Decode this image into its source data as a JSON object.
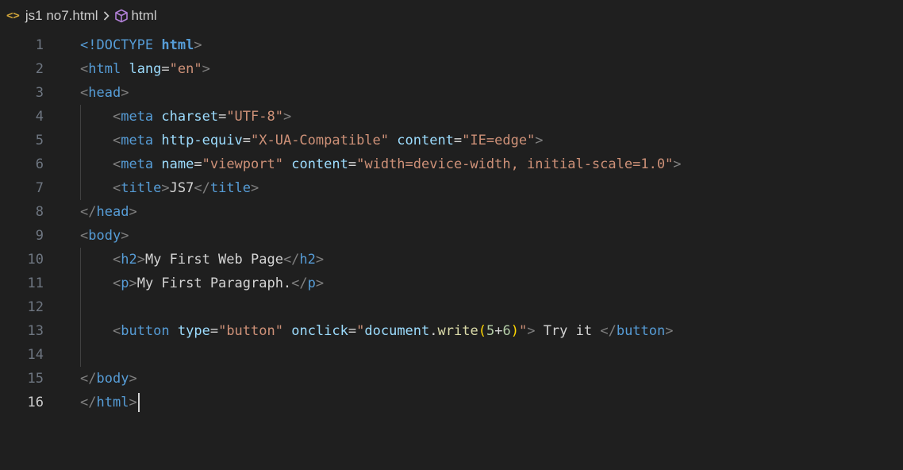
{
  "breadcrumb": {
    "file_icon": "<>",
    "file": "js1 no7.html",
    "separator": ">",
    "symbol_icon": "cube-icon",
    "symbol": "html"
  },
  "editor": {
    "active_line": 16,
    "lines": [
      {
        "n": "1",
        "tokens": [
          {
            "t": "<!DOCTYPE ",
            "c": "tag"
          },
          {
            "t": "html",
            "c": "tagb"
          },
          {
            "t": ">",
            "c": "bracket"
          }
        ]
      },
      {
        "n": "2",
        "tokens": [
          {
            "t": "<",
            "c": "bracket"
          },
          {
            "t": "html",
            "c": "tag"
          },
          {
            "t": " ",
            "c": "text"
          },
          {
            "t": "lang",
            "c": "attr"
          },
          {
            "t": "=",
            "c": "eq"
          },
          {
            "t": "\"en\"",
            "c": "str"
          },
          {
            "t": ">",
            "c": "bracket"
          }
        ]
      },
      {
        "n": "3",
        "tokens": [
          {
            "t": "<",
            "c": "bracket"
          },
          {
            "t": "head",
            "c": "tag"
          },
          {
            "t": ">",
            "c": "bracket"
          }
        ]
      },
      {
        "n": "4",
        "tokens": [
          {
            "t": "    ",
            "c": "text"
          },
          {
            "t": "<",
            "c": "bracket"
          },
          {
            "t": "meta",
            "c": "tag"
          },
          {
            "t": " ",
            "c": "text"
          },
          {
            "t": "charset",
            "c": "attr"
          },
          {
            "t": "=",
            "c": "eq"
          },
          {
            "t": "\"UTF-8\"",
            "c": "str"
          },
          {
            "t": ">",
            "c": "bracket"
          }
        ]
      },
      {
        "n": "5",
        "tokens": [
          {
            "t": "    ",
            "c": "text"
          },
          {
            "t": "<",
            "c": "bracket"
          },
          {
            "t": "meta",
            "c": "tag"
          },
          {
            "t": " ",
            "c": "text"
          },
          {
            "t": "http-equiv",
            "c": "attr"
          },
          {
            "t": "=",
            "c": "eq"
          },
          {
            "t": "\"X-UA-Compatible\"",
            "c": "str"
          },
          {
            "t": " ",
            "c": "text"
          },
          {
            "t": "content",
            "c": "attr"
          },
          {
            "t": "=",
            "c": "eq"
          },
          {
            "t": "\"IE=edge\"",
            "c": "str"
          },
          {
            "t": ">",
            "c": "bracket"
          }
        ]
      },
      {
        "n": "6",
        "tokens": [
          {
            "t": "    ",
            "c": "text"
          },
          {
            "t": "<",
            "c": "bracket"
          },
          {
            "t": "meta",
            "c": "tag"
          },
          {
            "t": " ",
            "c": "text"
          },
          {
            "t": "name",
            "c": "attr"
          },
          {
            "t": "=",
            "c": "eq"
          },
          {
            "t": "\"viewport\"",
            "c": "str"
          },
          {
            "t": " ",
            "c": "text"
          },
          {
            "t": "content",
            "c": "attr"
          },
          {
            "t": "=",
            "c": "eq"
          },
          {
            "t": "\"width=device-width, initial-scale=1.0\"",
            "c": "str"
          },
          {
            "t": ">",
            "c": "bracket"
          }
        ]
      },
      {
        "n": "7",
        "tokens": [
          {
            "t": "    ",
            "c": "text"
          },
          {
            "t": "<",
            "c": "bracket"
          },
          {
            "t": "title",
            "c": "tag"
          },
          {
            "t": ">",
            "c": "bracket"
          },
          {
            "t": "JS7",
            "c": "text"
          },
          {
            "t": "</",
            "c": "bracket"
          },
          {
            "t": "title",
            "c": "tag"
          },
          {
            "t": ">",
            "c": "bracket"
          }
        ]
      },
      {
        "n": "8",
        "tokens": [
          {
            "t": "</",
            "c": "bracket"
          },
          {
            "t": "head",
            "c": "tag"
          },
          {
            "t": ">",
            "c": "bracket"
          }
        ]
      },
      {
        "n": "9",
        "tokens": [
          {
            "t": "<",
            "c": "bracket"
          },
          {
            "t": "body",
            "c": "tag"
          },
          {
            "t": ">",
            "c": "bracket"
          }
        ]
      },
      {
        "n": "10",
        "tokens": [
          {
            "t": "    ",
            "c": "text"
          },
          {
            "t": "<",
            "c": "bracket"
          },
          {
            "t": "h2",
            "c": "tag"
          },
          {
            "t": ">",
            "c": "bracket"
          },
          {
            "t": "My First Web Page",
            "c": "text"
          },
          {
            "t": "</",
            "c": "bracket"
          },
          {
            "t": "h2",
            "c": "tag"
          },
          {
            "t": ">",
            "c": "bracket"
          }
        ]
      },
      {
        "n": "11",
        "tokens": [
          {
            "t": "    ",
            "c": "text"
          },
          {
            "t": "<",
            "c": "bracket"
          },
          {
            "t": "p",
            "c": "tag"
          },
          {
            "t": ">",
            "c": "bracket"
          },
          {
            "t": "My First Paragraph.",
            "c": "text"
          },
          {
            "t": "</",
            "c": "bracket"
          },
          {
            "t": "p",
            "c": "tag"
          },
          {
            "t": ">",
            "c": "bracket"
          }
        ]
      },
      {
        "n": "12",
        "tokens": []
      },
      {
        "n": "13",
        "tokens": [
          {
            "t": "    ",
            "c": "text"
          },
          {
            "t": "<",
            "c": "bracket"
          },
          {
            "t": "button",
            "c": "tag"
          },
          {
            "t": " ",
            "c": "text"
          },
          {
            "t": "type",
            "c": "attr"
          },
          {
            "t": "=",
            "c": "eq"
          },
          {
            "t": "\"button\"",
            "c": "str"
          },
          {
            "t": " ",
            "c": "text"
          },
          {
            "t": "onclick",
            "c": "attr"
          },
          {
            "t": "=",
            "c": "eq"
          },
          {
            "t": "\"",
            "c": "str"
          },
          {
            "t": "document",
            "c": "attr"
          },
          {
            "t": ".",
            "c": "text"
          },
          {
            "t": "write",
            "c": "fn"
          },
          {
            "t": "(",
            "c": "paren"
          },
          {
            "t": "5",
            "c": "num"
          },
          {
            "t": "+",
            "c": "text"
          },
          {
            "t": "6",
            "c": "num"
          },
          {
            "t": ")",
            "c": "paren"
          },
          {
            "t": "\"",
            "c": "str"
          },
          {
            "t": ">",
            "c": "bracket"
          },
          {
            "t": " Try it ",
            "c": "text"
          },
          {
            "t": "</",
            "c": "bracket"
          },
          {
            "t": "button",
            "c": "tag"
          },
          {
            "t": ">",
            "c": "bracket"
          }
        ]
      },
      {
        "n": "14",
        "tokens": []
      },
      {
        "n": "15",
        "tokens": [
          {
            "t": "</",
            "c": "bracket"
          },
          {
            "t": "body",
            "c": "tag"
          },
          {
            "t": ">",
            "c": "bracket"
          }
        ]
      },
      {
        "n": "16",
        "tokens": [
          {
            "t": "</",
            "c": "bracket"
          },
          {
            "t": "html",
            "c": "tag"
          },
          {
            "t": ">",
            "c": "bracket"
          }
        ]
      }
    ]
  }
}
